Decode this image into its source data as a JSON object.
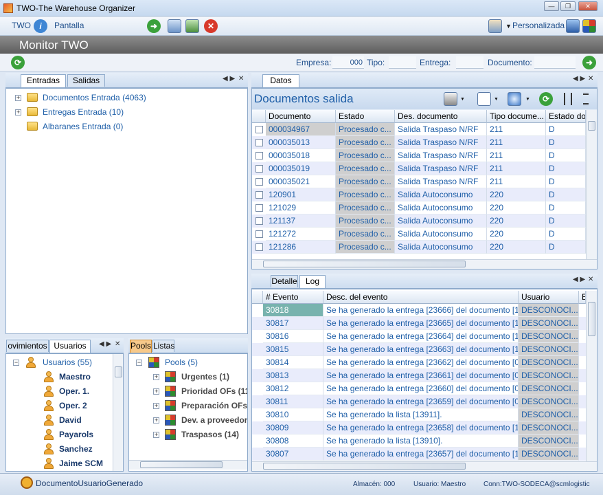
{
  "window": {
    "title": "TWO-The Warehouse Organizer"
  },
  "toolbar": {
    "app_label": "TWO",
    "screen_label": "Pantalla",
    "personalizada_label": "Personalizada"
  },
  "header": {
    "title": "Monitor TWO"
  },
  "filters": {
    "empresa_label": "Empresa:",
    "empresa_value": "000",
    "tipo_label": "Tipo:",
    "entrega_label": "Entrega:",
    "documento_label": "Documento:"
  },
  "left_panel": {
    "tabs": [
      "Entradas",
      "Salidas"
    ],
    "tree": [
      {
        "label": "Documentos Entrada (4063)"
      },
      {
        "label": "Entregas Entrada (10)"
      },
      {
        "label": "Albaranes Entrada (0)"
      }
    ]
  },
  "users_panel": {
    "tabs": [
      "ovimientos",
      "Usuarios"
    ],
    "root": "Usuarios (55)",
    "users": [
      "Maestro",
      "Oper. 1.",
      "Oper. 2",
      "David",
      "Payarols",
      "Sanchez",
      "Jaime SCM"
    ]
  },
  "pools_panel": {
    "tabs": [
      "Pools",
      "Listas"
    ],
    "root": "Pools (5)",
    "items": [
      "Urgentes (1)",
      "Prioridad OFs (11",
      "Preparación OFs",
      "Dev. a proveedor",
      "Traspasos (14)"
    ]
  },
  "docs_panel": {
    "tab": "Datos",
    "title": "Documentos salida",
    "columns": [
      "Documento",
      "Estado",
      "Des. documento",
      "Tipo docume...",
      "Estado do"
    ],
    "rows": [
      [
        "000034967",
        "Procesado c...",
        "Salida Traspaso N/RF",
        "211",
        "D"
      ],
      [
        "000035013",
        "Procesado c...",
        "Salida Traspaso N/RF",
        "211",
        "D"
      ],
      [
        "000035018",
        "Procesado c...",
        "Salida Traspaso N/RF",
        "211",
        "D"
      ],
      [
        "000035019",
        "Procesado c...",
        "Salida Traspaso N/RF",
        "211",
        "D"
      ],
      [
        "000035021",
        "Procesado c...",
        "Salida Traspaso N/RF",
        "211",
        "D"
      ],
      [
        "120901",
        "Procesado c...",
        "Salida Autoconsumo",
        "220",
        "D"
      ],
      [
        "121029",
        "Procesado c...",
        "Salida Autoconsumo",
        "220",
        "D"
      ],
      [
        "121137",
        "Procesado c...",
        "Salida Autoconsumo",
        "220",
        "D"
      ],
      [
        "121272",
        "Procesado c...",
        "Salida Autoconsumo",
        "220",
        "D"
      ],
      [
        "121286",
        "Procesado c...",
        "Salida Autoconsumo",
        "220",
        "D"
      ]
    ]
  },
  "log_panel": {
    "tabs": [
      "Detalle",
      "Log"
    ],
    "columns": [
      "# Evento",
      "Desc. del evento",
      "Usuario",
      "E"
    ],
    "rows": [
      [
        "30818",
        "Se ha generado la entrega [23666] del documento [1...",
        "DESCONOCI..."
      ],
      [
        "30817",
        "Se ha generado la entrega [23665] del documento [1...",
        "DESCONOCI..."
      ],
      [
        "30816",
        "Se ha generado la entrega [23664] del documento [1...",
        "DESCONOCI..."
      ],
      [
        "30815",
        "Se ha generado la entrega [23663] del documento [1...",
        "DESCONOCI..."
      ],
      [
        "30814",
        "Se ha generado la entrega [23662] del documento [0...",
        "DESCONOCI..."
      ],
      [
        "30813",
        "Se ha generado la entrega [23661] del documento [0...",
        "DESCONOCI..."
      ],
      [
        "30812",
        "Se ha generado la entrega [23660] del documento [0...",
        "DESCONOCI..."
      ],
      [
        "30811",
        "Se ha generado la entrega [23659] del documento [0...",
        "DESCONOCI..."
      ],
      [
        "30810",
        "Se ha generado la lista [13911].",
        "DESCONOCI..."
      ],
      [
        "30809",
        "Se ha generado la entrega [23658] del documento [1...",
        "DESCONOCI..."
      ],
      [
        "30808",
        "Se ha generado la lista [13910].",
        "DESCONOCI..."
      ],
      [
        "30807",
        "Se ha generado la entrega [23657] del documento [1...",
        "DESCONOCI..."
      ]
    ]
  },
  "statusbar": {
    "message": "DocumentoUsuarioGenerado",
    "almacen": "Almacén: 000",
    "usuario": "Usuario: Maestro",
    "conn": "Conn:TWO-SODECA@scmlogistic"
  }
}
